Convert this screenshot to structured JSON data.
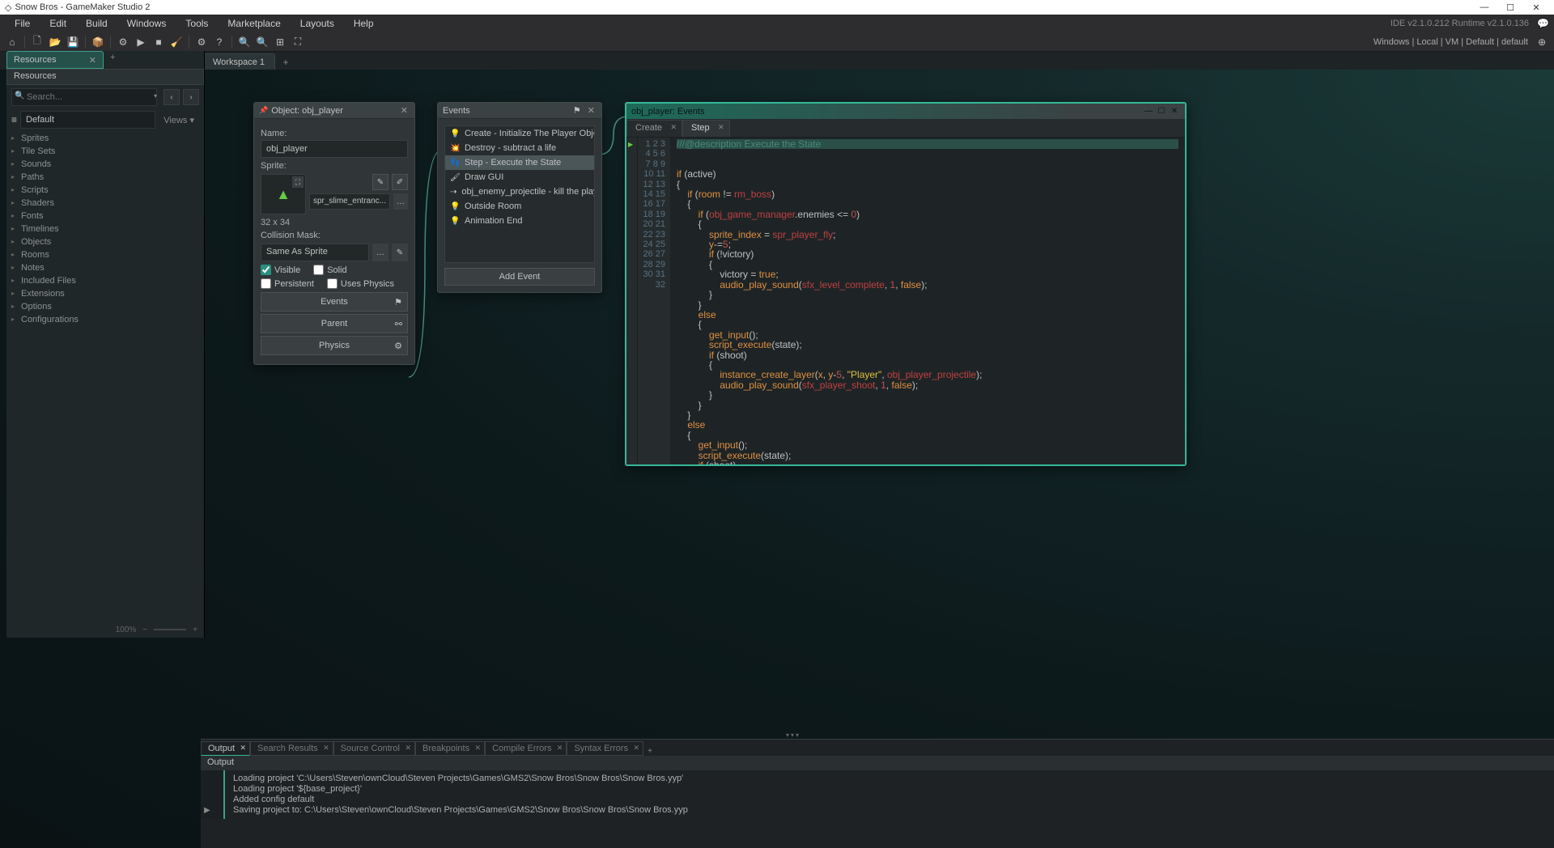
{
  "window": {
    "title": "Snow Bros - GameMaker Studio 2",
    "ide_version": "IDE v2.1.0.212 Runtime v2.1.0.136"
  },
  "menu": [
    "File",
    "Edit",
    "Build",
    "Windows",
    "Tools",
    "Marketplace",
    "Layouts",
    "Help"
  ],
  "target_text": "Windows  |  Local  |  VM  |  Default  |  default",
  "workspace_tab": "Workspace 1",
  "resources": {
    "panel_title": "Resources",
    "header": "Resources",
    "search_placeholder": "Search...",
    "filter": "Default",
    "views_label": "Views ▾",
    "zoom": "100%",
    "items": [
      "Sprites",
      "Tile Sets",
      "Sounds",
      "Paths",
      "Scripts",
      "Shaders",
      "Fonts",
      "Timelines",
      "Objects",
      "Rooms",
      "Notes",
      "Included Files",
      "Extensions",
      "Options",
      "Configurations"
    ]
  },
  "object_panel": {
    "title": "Object: obj_player",
    "name_label": "Name:",
    "name_value": "obj_player",
    "sprite_label": "Sprite:",
    "sprite_value": "spr_slime_entranc...",
    "dimensions": "32 x 34",
    "mask_label": "Collision Mask:",
    "mask_value": "Same As Sprite",
    "visible": "Visible",
    "solid": "Solid",
    "persistent": "Persistent",
    "uses_physics": "Uses Physics",
    "btn_events": "Events",
    "btn_parent": "Parent",
    "btn_physics": "Physics"
  },
  "events_panel": {
    "title": "Events",
    "add_event": "Add Event",
    "items": [
      {
        "icon": "💡",
        "label": "Create - Initialize The Player Object"
      },
      {
        "icon": "💥",
        "label": "Destroy - subtract a life"
      },
      {
        "icon": "👣",
        "label": "Step - Execute the State",
        "selected": true
      },
      {
        "icon": "🖌",
        "label": "Draw GUI"
      },
      {
        "icon": "⇢",
        "label": "obj_enemy_projectile - kill the player"
      },
      {
        "icon": "💡",
        "label": "Outside Room"
      },
      {
        "icon": "💡",
        "label": "Animation End"
      }
    ]
  },
  "code_panel": {
    "title": "obj_player: Events",
    "tabs": [
      {
        "label": "Create",
        "active": false
      },
      {
        "label": "Step",
        "active": true
      }
    ]
  },
  "output": {
    "tabs": [
      "Output",
      "Search Results",
      "Source Control",
      "Breakpoints",
      "Compile Errors",
      "Syntax Errors"
    ],
    "header": "Output",
    "lines": [
      "Loading project 'C:\\Users\\Steven\\ownCloud\\Steven Projects\\Games\\GMS2\\Snow Bros\\Snow Bros\\Snow Bros.yyp'",
      "Loading project '${base_project}'",
      "Added config default",
      "Saving project to: C:\\Users\\Steven\\ownCloud\\Steven Projects\\Games\\GMS2\\Snow Bros\\Snow Bros\\Snow Bros.yyp"
    ]
  }
}
